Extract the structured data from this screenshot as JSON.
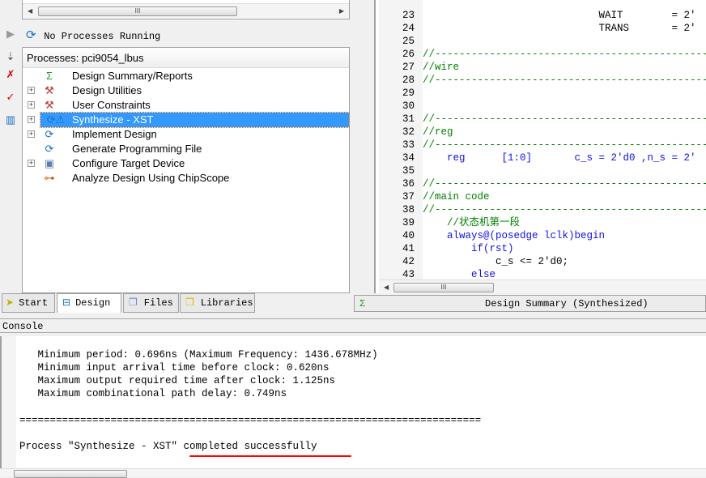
{
  "process_status": "No Processes Running",
  "processes_header": "Processes: pci9054_lbus",
  "processes": [
    {
      "label": "Design Summary/Reports",
      "icon": "sigma-icon",
      "expandable": false
    },
    {
      "label": "Design Utilities",
      "icon": "tools-icon",
      "expandable": true
    },
    {
      "label": "User Constraints",
      "icon": "tools-icon",
      "expandable": true
    },
    {
      "label": "Synthesize - XST",
      "icon": "warning-icon",
      "expandable": true,
      "selected": true
    },
    {
      "label": "Implement Design",
      "icon": "refresh-icon",
      "expandable": true
    },
    {
      "label": "Generate Programming File",
      "icon": "refresh-icon",
      "expandable": false
    },
    {
      "label": "Configure Target Device",
      "icon": "device-icon",
      "expandable": true
    },
    {
      "label": "Analyze Design Using ChipScope",
      "icon": "chipscope-icon",
      "expandable": false
    }
  ],
  "tabs": {
    "start": "Start",
    "design": "Design",
    "files": "Files",
    "libraries": "Libraries",
    "right": "Design Summary (Synthesized)"
  },
  "console_label": "Console",
  "code": [
    {
      "n": "23",
      "t": "                             WAIT        = 2'"
    },
    {
      "n": "24",
      "t": "                             TRANS       = 2'"
    },
    {
      "n": "25",
      "t": ""
    },
    {
      "n": "26",
      "t": "//--------------------------------------------------",
      "c": "cm"
    },
    {
      "n": "27",
      "t": "//wire",
      "c": "cm"
    },
    {
      "n": "28",
      "t": "//--------------------------------------------------",
      "c": "cm"
    },
    {
      "n": "29",
      "t": ""
    },
    {
      "n": "30",
      "t": ""
    },
    {
      "n": "31",
      "t": "//--------------------------------------------------",
      "c": "cm"
    },
    {
      "n": "32",
      "t": "//reg",
      "c": "cm"
    },
    {
      "n": "33",
      "t": "//--------------------------------------------------",
      "c": "cm"
    },
    {
      "n": "34",
      "t": "    reg      [1:0]       c_s = 2'd0 ,n_s = 2'"
    },
    {
      "n": "35",
      "t": ""
    },
    {
      "n": "36",
      "t": "//--------------------------------------------------",
      "c": "cm"
    },
    {
      "n": "37",
      "t": "//main code",
      "c": "cm"
    },
    {
      "n": "38",
      "t": "//--------------------------------------------------",
      "c": "cm"
    },
    {
      "n": "39",
      "t": "    //状态机第一段",
      "c": "cm"
    },
    {
      "n": "40",
      "t": "    always@(posedge lclk)begin"
    },
    {
      "n": "41",
      "t": "        if(rst)"
    },
    {
      "n": "42",
      "t": "            c_s <= 2'd0;"
    },
    {
      "n": "43",
      "t": "        else"
    }
  ],
  "console": [
    "   Minimum period: 0.696ns (Maximum Frequency: 1436.678MHz)",
    "   Minimum input arrival time before clock: 0.620ns",
    "   Maximum output required time after clock: 1.125ns",
    "   Maximum combinational path delay: 0.749ns",
    "",
    "============================================================================",
    "",
    "Process \"Synthesize - XST\" completed successfully"
  ],
  "colors": {
    "selection": "#3399ff",
    "comment": "#008000",
    "keyword": "#1010e0",
    "underline": "#ff0000"
  }
}
